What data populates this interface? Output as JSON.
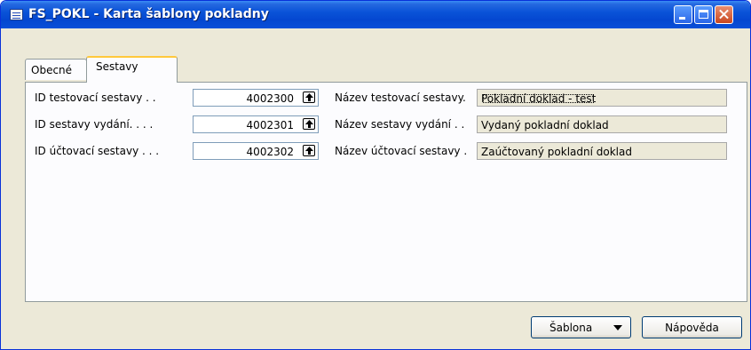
{
  "window": {
    "title": "FS_POKL - Karta šablony pokladny"
  },
  "tabs": [
    {
      "label": "Obecné"
    },
    {
      "label": "Sestavy"
    }
  ],
  "fields": [
    {
      "label": "ID testovací sestavy  . .",
      "id_value": "4002300",
      "name_label": "Název testovací sestavy.",
      "name_value": "Pokladní doklad - test"
    },
    {
      "label": "ID sestavy vydání. . . .",
      "id_value": "4002301",
      "name_label": "Název sestavy vydání . .",
      "name_value": "Vydaný pokladní doklad"
    },
    {
      "label": "ID účtovací sestavy . . .",
      "id_value": "4002302",
      "name_label": "Název účtovací sestavy .",
      "name_value": "Zaúčtovaný pokladní doklad"
    }
  ],
  "buttons": {
    "template_label": "Šablona",
    "help_label": "Nápověda"
  }
}
